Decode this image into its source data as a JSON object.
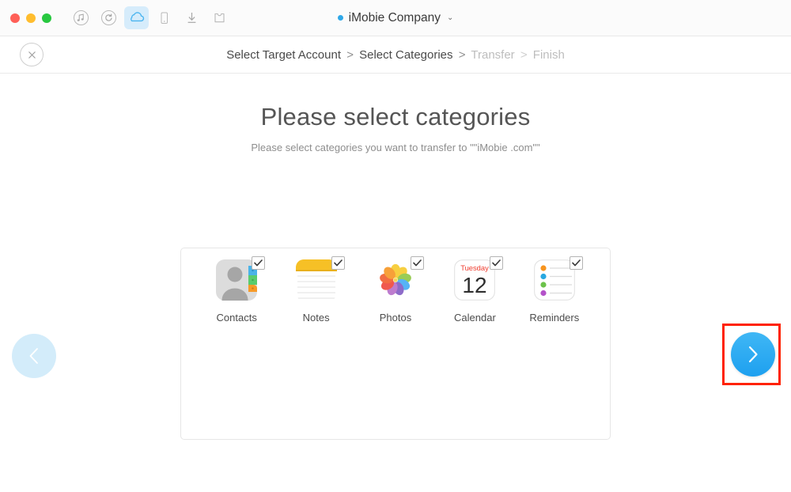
{
  "window": {
    "traffic_lights": [
      {
        "name": "close",
        "color": "#ff5f57"
      },
      {
        "name": "minimize",
        "color": "#ffbd2e"
      },
      {
        "name": "zoom",
        "color": "#28c840"
      }
    ],
    "toolbar": [
      {
        "icon": "music-note-icon",
        "active": false
      },
      {
        "icon": "restore-circle-icon",
        "active": false
      },
      {
        "icon": "cloud-icon",
        "active": true
      },
      {
        "icon": "device-phone-icon",
        "active": false
      },
      {
        "icon": "download-arrow-icon",
        "active": false
      },
      {
        "icon": "toolkit-shirt-icon",
        "active": false
      }
    ],
    "account_name": "iMobie Company",
    "account_caret": "⌄",
    "status_dot_color": "#2fa8e8"
  },
  "nav": {
    "close_label": "✕",
    "breadcrumb": {
      "step1": "Select Target Account",
      "sep1": ">",
      "step2": "Select Categories",
      "sep2": ">",
      "step3": "Transfer",
      "sep3": ">",
      "step4": "Finish"
    }
  },
  "main": {
    "heading": "Please select categories",
    "subheading": "Please select categories you want to transfer to \"\"iMobie .com\"\"",
    "categories": [
      {
        "id": "contacts",
        "label": "Contacts",
        "icon": "contacts-icon",
        "checked": true
      },
      {
        "id": "notes",
        "label": "Notes",
        "icon": "notes-icon",
        "checked": true
      },
      {
        "id": "photos",
        "label": "Photos",
        "icon": "photos-icon",
        "checked": true
      },
      {
        "id": "calendar",
        "label": "Calendar",
        "icon": "calendar-icon",
        "checked": true,
        "day_label": "Tuesday",
        "day_number": "12"
      },
      {
        "id": "reminders",
        "label": "Reminders",
        "icon": "reminders-icon",
        "checked": true
      }
    ],
    "checkmark": "✓"
  },
  "controls": {
    "prev_label": "‹",
    "next_label": "›",
    "prev_enabled": false,
    "next_enabled": true,
    "highlight_color": "#ff2200",
    "next_color": "#1ea0ef"
  }
}
